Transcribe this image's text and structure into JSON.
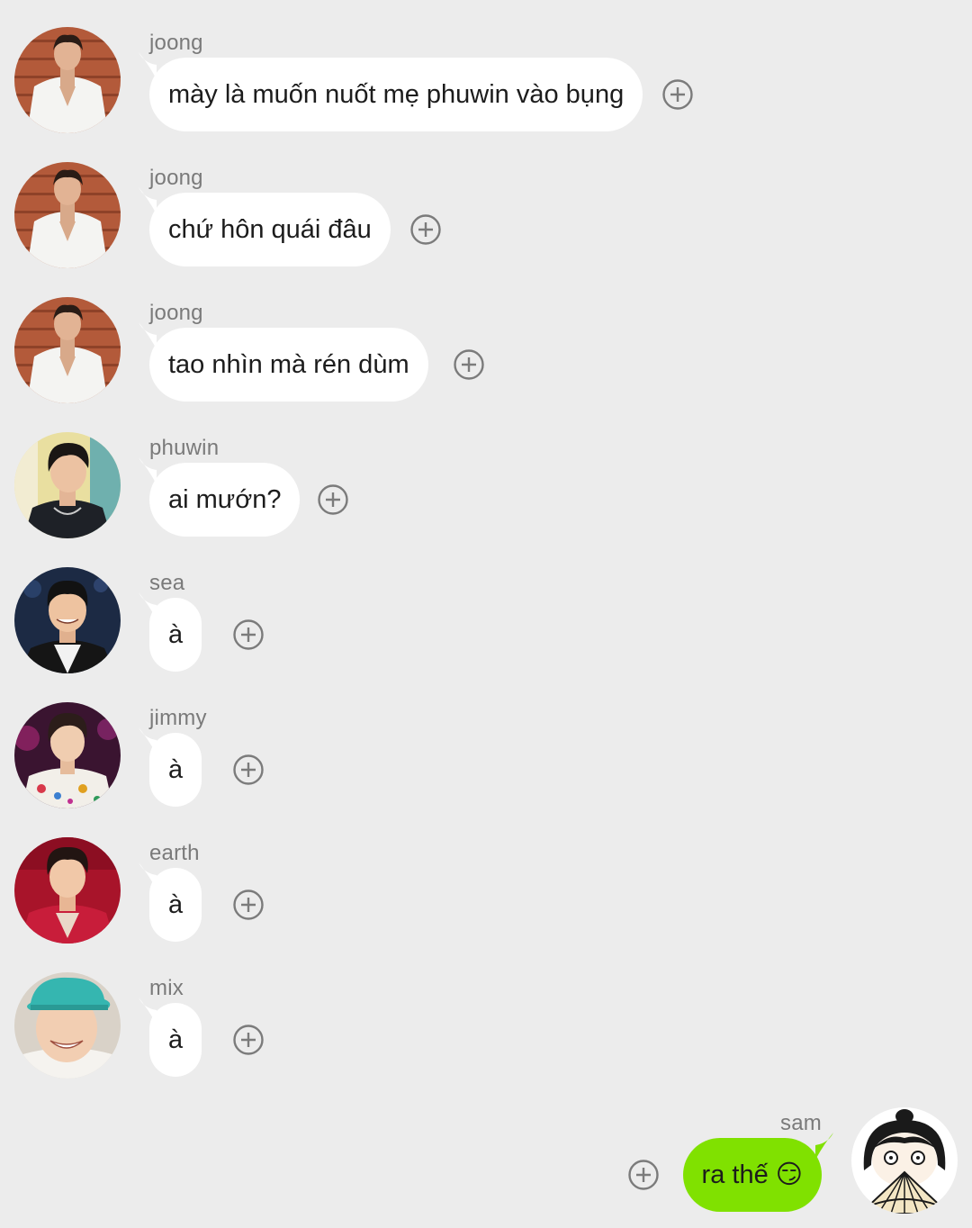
{
  "messages": [
    {
      "sender": "joong",
      "text": "mày là muốn nuốt mẹ phuwin vào bụng",
      "avatar_icon": "joong-avatar"
    },
    {
      "sender": "joong",
      "text": "chứ hôn quái đâu",
      "avatar_icon": "joong-avatar"
    },
    {
      "sender": "joong",
      "text": "tao nhìn mà rén dùm",
      "avatar_icon": "joong-avatar"
    },
    {
      "sender": "phuwin",
      "text": "ai mướn?",
      "avatar_icon": "phuwin-avatar"
    },
    {
      "sender": "sea",
      "text": "à",
      "avatar_icon": "sea-avatar"
    },
    {
      "sender": "jimmy",
      "text": "à",
      "avatar_icon": "jimmy-avatar"
    },
    {
      "sender": "earth",
      "text": "à",
      "avatar_icon": "earth-avatar"
    },
    {
      "sender": "mix",
      "text": "à",
      "avatar_icon": "mix-avatar"
    }
  ],
  "own_message": {
    "sender": "sam",
    "text": "ra thế 😏",
    "avatar_icon": "sam-avatar"
  },
  "react_icon": "add-reaction-icon",
  "colors": {
    "background": "#ececec",
    "incoming_bubble": "#ffffff",
    "outgoing_bubble": "#80e100",
    "sender_name": "#7a7a7a",
    "message_text": "#1c1c1c",
    "plus_icon": "#7b7b7b"
  }
}
